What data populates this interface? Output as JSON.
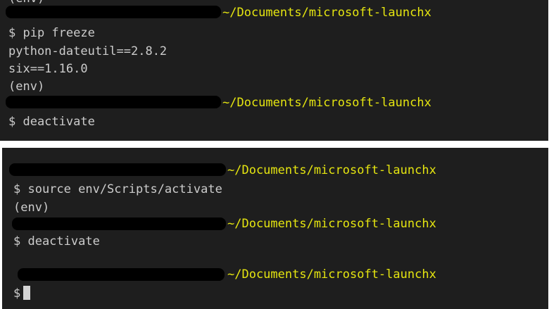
{
  "colors": {
    "terminal_bg": "#1e1e1e",
    "text": "#cccccc",
    "path": "#e5e510",
    "redaction": "#000000",
    "page_bg": "#ffffff"
  },
  "top_terminal": {
    "lines": [
      "(env)",
      "~/Documents/microsoft-launchx",
      "$ pip freeze",
      "python-dateutil==2.8.2",
      "six==1.16.0",
      "(env)",
      "~/Documents/microsoft-launchx",
      "$ deactivate"
    ]
  },
  "bottom_terminal": {
    "lines": [
      "~/Documents/microsoft-launchx",
      "$ source env/Scripts/activate",
      "(env)",
      "~/Documents/microsoft-launchx",
      "$ deactivate",
      "~/Documents/microsoft-launchx",
      "$"
    ]
  }
}
